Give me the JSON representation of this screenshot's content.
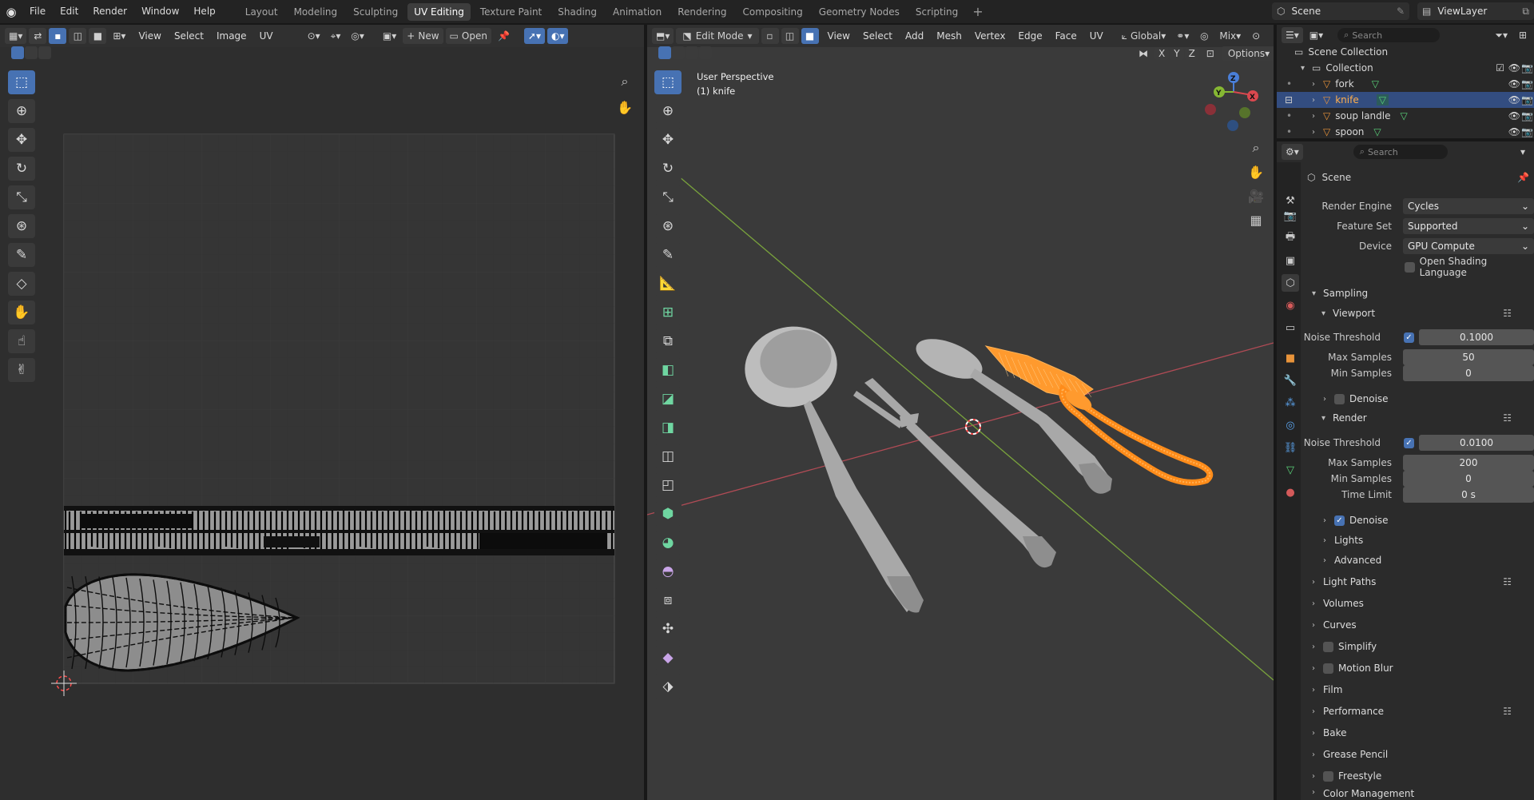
{
  "topbar": {
    "menus": [
      "File",
      "Edit",
      "Render",
      "Window",
      "Help"
    ],
    "workspaces": [
      "Layout",
      "Modeling",
      "Sculpting",
      "UV Editing",
      "Texture Paint",
      "Shading",
      "Animation",
      "Rendering",
      "Compositing",
      "Geometry Nodes",
      "Scripting"
    ],
    "active_workspace": "UV Editing",
    "add": "+",
    "scene": "Scene",
    "view_layer": "ViewLayer"
  },
  "uv_editor": {
    "menus": [
      "View",
      "Select",
      "Image",
      "UV"
    ],
    "new_label": "New",
    "open_label": "Open"
  },
  "viewport": {
    "mode": "Edit Mode",
    "menus": [
      "View",
      "Select",
      "Add",
      "Mesh",
      "Vertex",
      "Edge",
      "Face",
      "UV"
    ],
    "orientation": "Global",
    "proportional": "Mix",
    "options": "Options",
    "perspective": "User Perspective",
    "active_object": "(1) knife",
    "axes": {
      "x": "X",
      "y": "Y",
      "z": "Z"
    }
  },
  "outliner": {
    "search_placeholder": "Search",
    "scene_collection": "Scene Collection",
    "collection": "Collection",
    "items": [
      {
        "name": "fork",
        "selected": false
      },
      {
        "name": "knife",
        "selected": true
      },
      {
        "name": "soup landle",
        "selected": false
      },
      {
        "name": "spoon",
        "selected": false
      }
    ]
  },
  "properties": {
    "search_placeholder": "Search",
    "context": "Scene",
    "render_engine": {
      "label": "Render Engine",
      "value": "Cycles"
    },
    "feature_set": {
      "label": "Feature Set",
      "value": "Supported"
    },
    "device": {
      "label": "Device",
      "value": "GPU Compute"
    },
    "osl": "Open Shading Language",
    "sampling": "Sampling",
    "viewport_sec": "Viewport",
    "vp_noise": {
      "label": "Noise Threshold",
      "value": "0.1000"
    },
    "vp_max": {
      "label": "Max Samples",
      "value": "50"
    },
    "vp_min": {
      "label": "Min Samples",
      "value": "0"
    },
    "vp_denoise": "Denoise",
    "render_sec": "Render",
    "r_noise": {
      "label": "Noise Threshold",
      "value": "0.0100"
    },
    "r_max": {
      "label": "Max Samples",
      "value": "200"
    },
    "r_min": {
      "label": "Min Samples",
      "value": "0"
    },
    "r_time": {
      "label": "Time Limit",
      "value": "0 s"
    },
    "r_denoise": "Denoise",
    "lights": "Lights",
    "advanced": "Advanced",
    "panels": [
      "Light Paths",
      "Volumes",
      "Curves",
      "Simplify",
      "Motion Blur",
      "Film",
      "Performance",
      "Bake",
      "Grease Pencil",
      "Freestyle",
      "Color Management"
    ]
  },
  "colors": {
    "accent": "#4772b3",
    "selection": "#ff8c1a",
    "x_axis": "#b8434f",
    "y_axis": "#7aa632"
  }
}
